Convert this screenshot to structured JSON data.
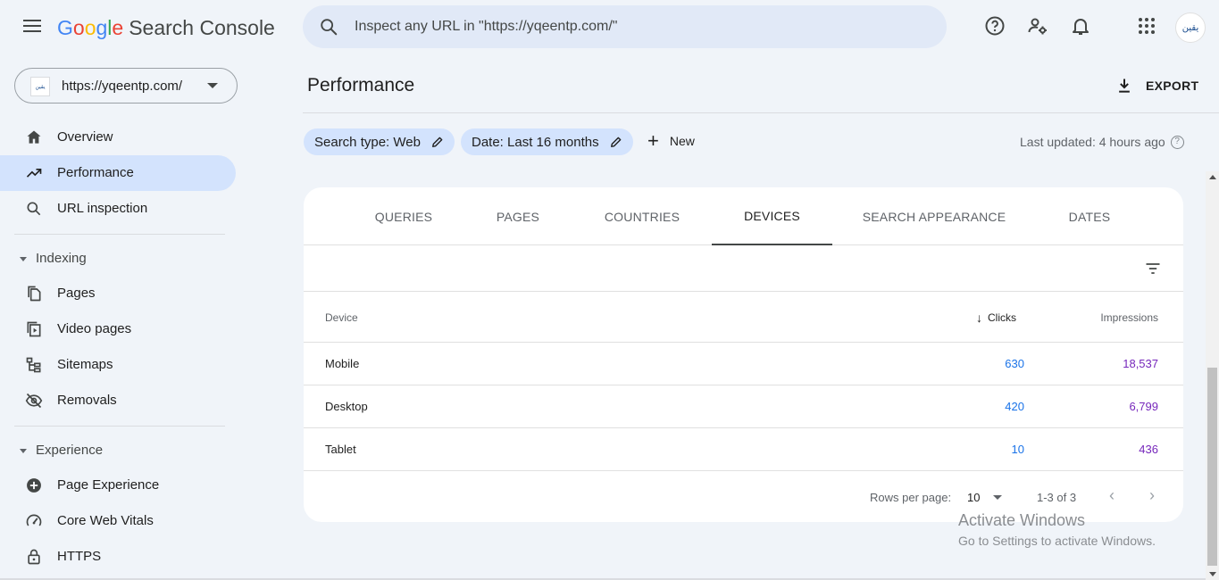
{
  "header": {
    "logo_google": [
      "G",
      "o",
      "o",
      "g",
      "l",
      "e"
    ],
    "logo_product": "Search Console",
    "search_placeholder": "Inspect any URL in \"https://yqeentp.com/\"",
    "avatar_text": "يقين"
  },
  "sidebar": {
    "property_url": "https://yqeentp.com/",
    "property_favicon_text": "يقين",
    "items_top": [
      {
        "label": "Overview",
        "icon": "home-icon"
      },
      {
        "label": "Performance",
        "icon": "trending-up-icon",
        "active": true
      },
      {
        "label": "URL inspection",
        "icon": "search-icon"
      }
    ],
    "section_indexing": "Indexing",
    "items_indexing": [
      {
        "label": "Pages",
        "icon": "pages-icon"
      },
      {
        "label": "Video pages",
        "icon": "video-pages-icon"
      },
      {
        "label": "Sitemaps",
        "icon": "sitemap-icon"
      },
      {
        "label": "Removals",
        "icon": "eye-off-icon"
      }
    ],
    "section_experience": "Experience",
    "items_experience": [
      {
        "label": "Page Experience",
        "icon": "add-circle-icon"
      },
      {
        "label": "Core Web Vitals",
        "icon": "speedometer-icon"
      },
      {
        "label": "HTTPS",
        "icon": "lock-icon"
      }
    ]
  },
  "main": {
    "title": "Performance",
    "export_label": "EXPORT",
    "chips": [
      {
        "label": "Search type: Web"
      },
      {
        "label": "Date: Last 16 months"
      }
    ],
    "new_label": "New",
    "last_updated": "Last updated: 4 hours ago",
    "tabs": [
      {
        "label": "QUERIES"
      },
      {
        "label": "PAGES"
      },
      {
        "label": "COUNTRIES"
      },
      {
        "label": "DEVICES",
        "active": true
      },
      {
        "label": "SEARCH APPEARANCE"
      },
      {
        "label": "DATES"
      }
    ],
    "table": {
      "headers": {
        "device": "Device",
        "clicks": "Clicks",
        "impressions": "Impressions"
      },
      "rows": [
        {
          "device": "Mobile",
          "clicks": "630",
          "impressions": "18,537"
        },
        {
          "device": "Desktop",
          "clicks": "420",
          "impressions": "6,799"
        },
        {
          "device": "Tablet",
          "clicks": "10",
          "impressions": "436"
        }
      ]
    },
    "pager": {
      "rows_per_page_label": "Rows per page:",
      "rows_per_page_value": "10",
      "range": "1-3 of 3"
    }
  },
  "watermark": {
    "line1": "Activate Windows",
    "line2": "Go to Settings to activate Windows."
  },
  "colors": {
    "clicks": "#1a73e8",
    "impressions": "#7627bb",
    "active_nav": "#d3e3fd",
    "search_bg": "#e1e9f7"
  }
}
